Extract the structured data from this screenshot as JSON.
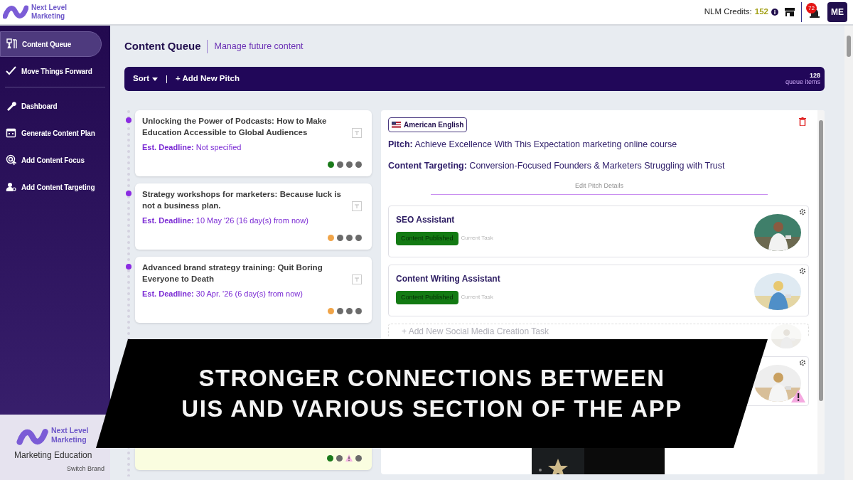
{
  "brand": {
    "line1": "Next Level",
    "line2": "Marketing"
  },
  "header": {
    "credits_label": "NLM Credits:",
    "credits_value": "152",
    "notification_count": "72",
    "avatar_initials": "ME"
  },
  "sidebar": {
    "groups": [
      [
        {
          "label": "Content Queue",
          "selected": true
        },
        {
          "label": "Move Things Forward",
          "selected": false
        }
      ],
      [
        {
          "label": "Dashboard",
          "selected": false
        },
        {
          "label": "Generate Content Plan",
          "selected": false
        },
        {
          "label": "Add Content Focus",
          "selected": false
        },
        {
          "label": "Add Content Targeting",
          "selected": false
        }
      ]
    ],
    "brand_line1": "Next Level",
    "brand_line2": "Marketing",
    "brand_subtitle": "Marketing Education",
    "switch_label": "Switch Brand"
  },
  "page": {
    "title": "Content Queue",
    "subtitle": "Manage future content"
  },
  "toolbar": {
    "sort": "Sort",
    "add": "+ Add New Pitch",
    "count": "128",
    "count_label": "queue items"
  },
  "queue": [
    {
      "title": "Unlocking the Power of Podcasts: How to Make Education Accessible to Global Audiences",
      "deadline_label": "Est. Deadline:",
      "deadline": "Not specified",
      "highlighted": false,
      "steps": [
        {
          "kind": "dot",
          "color": "#1a7a1a"
        },
        {
          "kind": "dot",
          "color": "#6b6b6b"
        },
        {
          "kind": "dot",
          "color": "#6b6b6b"
        },
        {
          "kind": "dot",
          "color": "#6b6b6b"
        }
      ]
    },
    {
      "title": "Strategy workshops for marketers: Because luck is not a business plan.",
      "deadline_label": "Est. Deadline:",
      "deadline": "10 May '26 (16 day(s) from now)",
      "highlighted": false,
      "steps": [
        {
          "kind": "dot",
          "color": "#f0a448"
        },
        {
          "kind": "dot",
          "color": "#6b6b6b"
        },
        {
          "kind": "dot",
          "color": "#6b6b6b"
        },
        {
          "kind": "dot",
          "color": "#6b6b6b"
        }
      ]
    },
    {
      "title": "Advanced brand strategy training: Quit Boring Everyone to Death",
      "deadline_label": "Est. Deadline:",
      "deadline": "30 Apr. '26 (6 day(s) from now)",
      "highlighted": false,
      "steps": [
        {
          "kind": "dot",
          "color": "#f0a448"
        },
        {
          "kind": "dot",
          "color": "#6b6b6b"
        },
        {
          "kind": "dot",
          "color": "#6b6b6b"
        },
        {
          "kind": "dot",
          "color": "#6b6b6b"
        }
      ]
    },
    {
      "highlighted": true,
      "steps": [
        {
          "kind": "dot",
          "color": "#1a7a1a"
        },
        {
          "kind": "dot",
          "color": "#6b6b6b"
        },
        {
          "kind": "warning"
        },
        {
          "kind": "dot",
          "color": "#6b6b6b"
        }
      ]
    }
  ],
  "detail": {
    "language": "American English",
    "pitch_label": "Pitch:",
    "pitch": "Achieve Excellence With This Expectation marketing online course",
    "targeting_label": "Content Targeting:",
    "targeting": "Conversion-Focused Founders & Marketers Struggling with Trust",
    "edit": "Edit Pitch Details",
    "tasks": [
      {
        "kind": "assistant",
        "name": "SEO Assistant",
        "status": "Content Published",
        "note": "Current Task",
        "warning": false
      },
      {
        "kind": "assistant",
        "name": "Content Writing Assistant",
        "status": "Content Published",
        "note": "Current Task",
        "warning": false
      },
      {
        "kind": "add",
        "label": "+ Add New Social Media Creation Task"
      },
      {
        "kind": "assistant",
        "warning": true
      }
    ]
  },
  "banner": {
    "lines": [
      "STRONGER CONNECTIONS BETWEEN",
      "UIS AND VARIOUS SECTION OF THE APP"
    ]
  }
}
